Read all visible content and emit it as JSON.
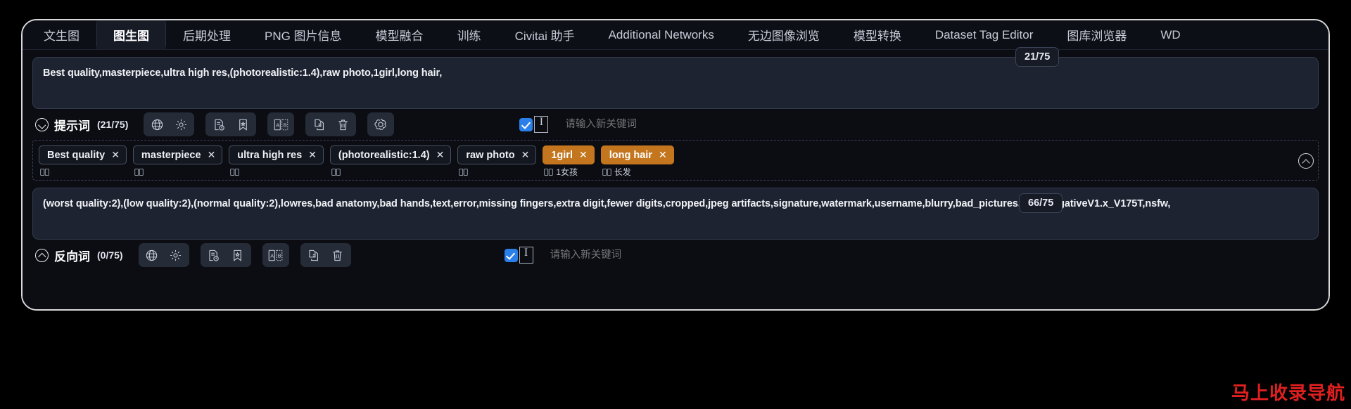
{
  "window": {
    "background": "#000000",
    "frame_border": "#d9d9d9"
  },
  "tabs": [
    {
      "label": "文生图",
      "active": false
    },
    {
      "label": "图生图",
      "active": true
    },
    {
      "label": "后期处理",
      "active": false
    },
    {
      "label": "PNG 图片信息",
      "active": false
    },
    {
      "label": "模型融合",
      "active": false
    },
    {
      "label": "训练",
      "active": false
    },
    {
      "label": "Civitai 助手",
      "active": false
    },
    {
      "label": "Additional Networks",
      "active": false
    },
    {
      "label": "无边图像浏览",
      "active": false
    },
    {
      "label": "模型转换",
      "active": false
    },
    {
      "label": "Dataset Tag Editor",
      "active": false
    },
    {
      "label": "图库浏览器",
      "active": false
    },
    {
      "label": "WD",
      "active": false
    }
  ],
  "positive": {
    "prompt_text": "Best quality,masterpiece,ultra high res,(photorealistic:1.4),raw photo,1girl,long hair,",
    "section_label": "提示词",
    "count": "(21/75)",
    "counter_badge": "21/75",
    "toolbar_groups": [
      {
        "icons": [
          "globe-icon",
          "gear-icon"
        ]
      },
      {
        "icons": [
          "styles-icon",
          "bookmark-icon"
        ]
      },
      {
        "icons": [
          "translate-ab-icon"
        ]
      },
      {
        "icons": [
          "copy-icon",
          "trash-icon"
        ]
      },
      {
        "icons": [
          "openai-icon"
        ]
      }
    ],
    "keyword_checked": true,
    "keyword_placeholder": "请输入新关键词",
    "keyword_value": "",
    "tags": [
      {
        "text": "Best quality",
        "color": "default",
        "sub": ""
      },
      {
        "text": "masterpiece",
        "color": "default",
        "sub": ""
      },
      {
        "text": "ultra high res",
        "color": "default",
        "sub": ""
      },
      {
        "text": "(photorealistic:1.4)",
        "color": "default",
        "weighted": true,
        "sub": ""
      },
      {
        "text": "raw photo",
        "color": "default",
        "sub": ""
      },
      {
        "text": "1girl",
        "color": "orange",
        "sub": "1女孩"
      },
      {
        "text": "long hair",
        "color": "orange",
        "sub": "长发"
      }
    ]
  },
  "negative": {
    "prompt_text": "(worst quality:2),(low quality:2),(normal quality:2),lowres,bad anatomy,bad hands,text,error,missing fingers,extra digit,fewer digits,cropped,jpeg artifacts,signature,watermark,username,blurry,bad_pictures,DeepNegativeV1.x_V175T,nsfw,",
    "section_label": "反向词",
    "count": "(0/75)",
    "counter_badge": "66/75",
    "toolbar_groups": [
      {
        "icons": [
          "globe-icon",
          "gear-icon"
        ]
      },
      {
        "icons": [
          "styles-icon",
          "bookmark-icon"
        ]
      },
      {
        "icons": [
          "translate-ab-icon"
        ]
      },
      {
        "icons": [
          "copy-icon",
          "trash-icon"
        ]
      }
    ],
    "keyword_checked": true,
    "keyword_placeholder": "请输入新关键词",
    "keyword_value": ""
  },
  "watermark": {
    "cn": "马上收录",
    "en": "导航",
    "full": "马上收录导航",
    "color": "#e02020"
  },
  "colors": {
    "accent_blue": "#2b7fe8",
    "tag_orange": "#c4761e",
    "panel_bg": "#1d2330",
    "app_bg": "#0b0d13"
  }
}
